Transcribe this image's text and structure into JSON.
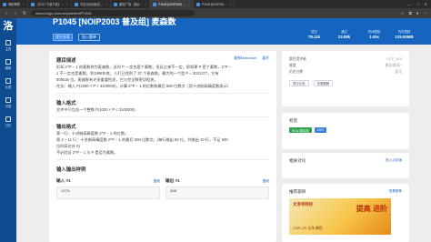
{
  "browser": {
    "tabs": [
      {
        "label": "神帽神帽",
        "active": false
      },
      {
        "label": "【2021 下载下载】…",
        "active": false
      },
      {
        "label": "不定分区间标志…",
        "active": false
      },
      {
        "label": "图标广场 - 洛谷…",
        "active": false
      },
      {
        "label": "P1045 [NOIP2003 …",
        "active": true
      },
      {
        "label": "P2045 [NOIP200…",
        "active": false
      }
    ],
    "url": "www.luogu.com.cn/problem/P1045"
  },
  "sidebar": {
    "logo": "洛",
    "items": [
      {
        "label": "主页"
      },
      {
        "label": "题库"
      },
      {
        "label": "比赛"
      },
      {
        "label": "记录"
      },
      {
        "label": "讨论"
      }
    ]
  },
  "header": {
    "title": "P1045 [NOIP2003 普及组] 麦森数",
    "submit_label": "提交答案",
    "join_label": "加入题单",
    "stats": [
      {
        "label": "提交",
        "value": "78.11k"
      },
      {
        "label": "通过",
        "value": "23.88k"
      },
      {
        "label": "时间限制",
        "value": "1.00s"
      },
      {
        "label": "内存限制",
        "value": "125.00MB"
      }
    ]
  },
  "content": {
    "section_title": "题目描述",
    "copy_markdown": "复制Markdown",
    "expand": "展开",
    "desc": [
      "形如 2^P − 1 的素数称为麦森数，这时 P 一定也是个素数。但反过来不一定，即如果 P 是个素数，2^P −",
      "1 不一定也是素数。到1998年底，人们已找到了 37 个麦森数。最大的一个是 P = 3021377，它有",
      "909526 位。麦森数有许多重要性质，它与完全数密切相关。",
      "任务：输入 P(1000 < P < 3100000)，计算 2^P − 1 的位数和最后 500 位数字（用十进制高精度数表示）"
    ],
    "input_title": "输入格式",
    "input_text": "文件中只包含一个整数 P(1000 < P < 3100000)",
    "output_title": "输出格式",
    "output_lines": [
      "第一行：十进制高精度数 2^P − 1 的位数。",
      "第 2 ~ 11 行：十进制高精度数 2^P − 1 的最后 500 位数字。(每行输出 50 位，共输出 10 行，不足 500",
      "位时高位补 0)",
      "不必验证 2^P − 1 与 P 是否为素数。"
    ],
    "sample_title": "输入输出样例",
    "sample_in_label": "输入 #1",
    "sample_out_label": "输出 #1",
    "sample_copy": "复制",
    "sample_in_value": "1279",
    "sample_out_value": "386"
  },
  "right": {
    "info": [
      {
        "k": "题目提供者",
        "v": "CCF_NOI"
      },
      {
        "k": "难度",
        "v": "普及/提高−"
      },
      {
        "k": "历史分数",
        "v": "暂无"
      }
    ],
    "btn_record": "提交记录",
    "btn_solution": "查看题解",
    "tags_title": "标签",
    "tags": [
      "NOIp 普及组",
      "2003"
    ],
    "discuss_title": "相关讨论",
    "discuss_action": "进入讨论版",
    "recommend_title": "推荐题目",
    "recommend_action": "查看推荐",
    "ad_brand": "文淳寻网校",
    "ad_text": "提高 进阶",
    "ad_sub": "CSP-J/S 全年课程"
  }
}
